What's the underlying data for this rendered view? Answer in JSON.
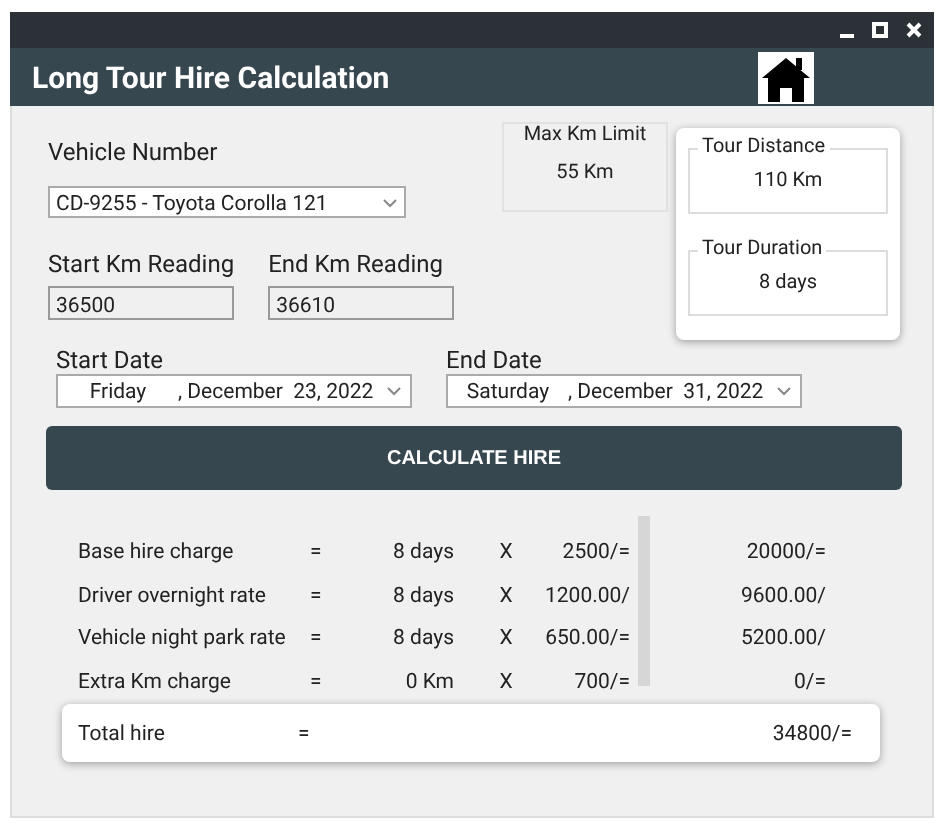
{
  "window": {
    "title": "Long Tour Hire Calculation"
  },
  "vehicle": {
    "label": "Vehicle Number",
    "value": "CD-9255 - Toyota Corolla 121"
  },
  "max_km": {
    "label": "Max Km Limit",
    "value": "55 Km"
  },
  "tour_distance": {
    "label": "Tour Distance",
    "value": "110 Km"
  },
  "tour_duration": {
    "label": "Tour Duration",
    "value": "8 days"
  },
  "start_km": {
    "label": "Start Km Reading",
    "value": "36500"
  },
  "end_km": {
    "label": "End Km Reading",
    "value": "36610"
  },
  "start_date": {
    "label": "Start Date",
    "day": "Friday",
    "date": ", December  23, 2022"
  },
  "end_date": {
    "label": "End Date",
    "day": "Saturday",
    "date": ", December  31, 2022"
  },
  "calculate_button": "CALCULATE HIRE",
  "charges": [
    {
      "label": "Base hire charge",
      "equals": "=",
      "quantity": "8 days",
      "times": "X",
      "rate": "2500/=",
      "amount": "20000/="
    },
    {
      "label": "Driver overnight rate",
      "equals": "=",
      "quantity": "8 days",
      "times": "X",
      "rate": "1200.00/",
      "amount": "9600.00/"
    },
    {
      "label": "Vehicle night park rate",
      "equals": "=",
      "quantity": "8 days",
      "times": "X",
      "rate": "650.00/=",
      "amount": "5200.00/"
    },
    {
      "label": "Extra Km charge",
      "equals": "=",
      "quantity": "0 Km",
      "times": "X",
      "rate": "700/=",
      "amount": "0/="
    }
  ],
  "total": {
    "label": "Total hire",
    "equals": "=",
    "amount": "34800/="
  }
}
